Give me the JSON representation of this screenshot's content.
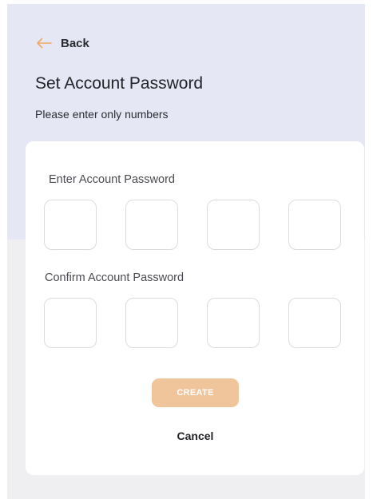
{
  "header": {
    "back_label": "Back",
    "back_icon": "arrow-left-icon",
    "title": "Set Account Password",
    "subtitle": "Please enter only numbers"
  },
  "form": {
    "enter_label": "Enter Account Password",
    "confirm_label": "Confirm Account Password",
    "enter_digits": [
      "",
      "",
      "",
      ""
    ],
    "confirm_digits": [
      "",
      "",
      "",
      ""
    ],
    "create_label": "CREATE",
    "cancel_label": "Cancel"
  },
  "colors": {
    "accent": "#f0a868",
    "create_button_disabled": "#f0c59c",
    "header_background": "#e5e7f5",
    "page_background": "#efeff2",
    "card_background": "#ffffff"
  }
}
